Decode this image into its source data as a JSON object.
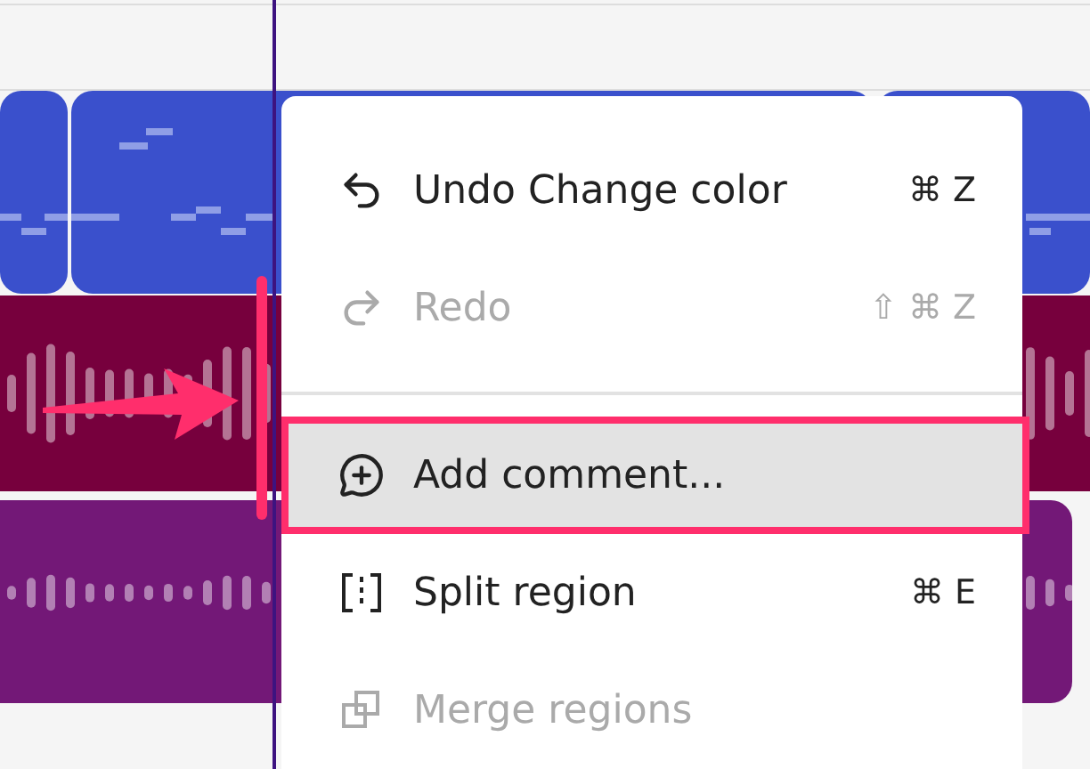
{
  "tracks": [
    {
      "kind": "midi",
      "color": "#3a50cc"
    },
    {
      "kind": "audio",
      "color": "#77003d"
    },
    {
      "kind": "audio",
      "color": "#731877"
    }
  ],
  "context_menu": {
    "items": [
      {
        "kind": "item",
        "label": "Undo Change color",
        "shortcut": "⌘ Z",
        "disabled": false,
        "selected": false
      },
      {
        "kind": "item",
        "label": "Redo",
        "shortcut": "⇧ ⌘ Z",
        "disabled": true,
        "selected": false
      },
      {
        "kind": "divider"
      },
      {
        "kind": "item",
        "label": "Add comment...",
        "disabled": false,
        "selected": true
      },
      {
        "kind": "item",
        "label": "Split region",
        "shortcut": "⌘ E",
        "disabled": false,
        "selected": false
      },
      {
        "kind": "item",
        "label": "Merge regions",
        "disabled": true,
        "selected": false
      }
    ]
  }
}
